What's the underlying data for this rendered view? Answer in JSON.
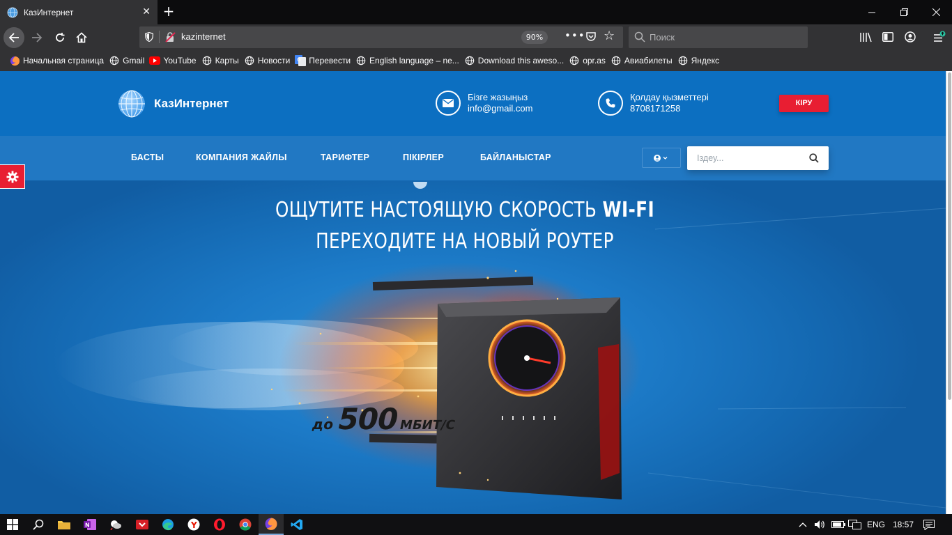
{
  "browser": {
    "tab_title": "КазИнтернет",
    "url": "kazinternet",
    "zoom": "90%",
    "search_placeholder": "Поиск",
    "bookmarks": [
      {
        "label": "Начальная страница",
        "icon": "firefox-icon"
      },
      {
        "label": "Gmail",
        "icon": "globe-icon"
      },
      {
        "label": "YouTube",
        "icon": "youtube-icon"
      },
      {
        "label": "Карты",
        "icon": "globe-icon"
      },
      {
        "label": "Новости",
        "icon": "globe-icon"
      },
      {
        "label": "Перевести",
        "icon": "google-translate-icon"
      },
      {
        "label": "English language – ne...",
        "icon": "globe-icon"
      },
      {
        "label": "Download this aweso...",
        "icon": "globe-icon"
      },
      {
        "label": "opr.as",
        "icon": "globe-icon"
      },
      {
        "label": "Авиабилеты",
        "icon": "globe-icon"
      },
      {
        "label": "Яндекс",
        "icon": "globe-icon"
      }
    ]
  },
  "site": {
    "logo_text": "КазИнтернет",
    "contact_email": {
      "title": "Бізге жазыңыз",
      "value": "info@gmail.com"
    },
    "contact_phone": {
      "title": "Қолдау қызметтері",
      "value": "8708171258"
    },
    "login_label": "КІРУ",
    "nav": [
      "БАСТЫ",
      "КОМПАНИЯ ЖАЙЛЫ",
      "ТАРИФТЕР",
      "ПІКІРЛЕР",
      "БАЙЛАНЫСТАР"
    ],
    "search_placeholder": "Іздеу..."
  },
  "hero": {
    "line1_regular": "ОЩУТИТЕ НАСТОЯЩУЮ СКОРОСТЬ",
    "line1_bold": "WI-FI",
    "line2": "ПЕРЕХОДИТЕ НА НОВЫЙ РОУТЕР",
    "speed_prefix": "до",
    "speed_value": "500",
    "speed_unit": "МБИТ/С"
  },
  "taskbar": {
    "lang": "ENG",
    "time": "18:57"
  },
  "colors": {
    "header_blue": "#0c6fc1",
    "nav_blue": "#2178c3",
    "accent_red": "#e81e32"
  }
}
